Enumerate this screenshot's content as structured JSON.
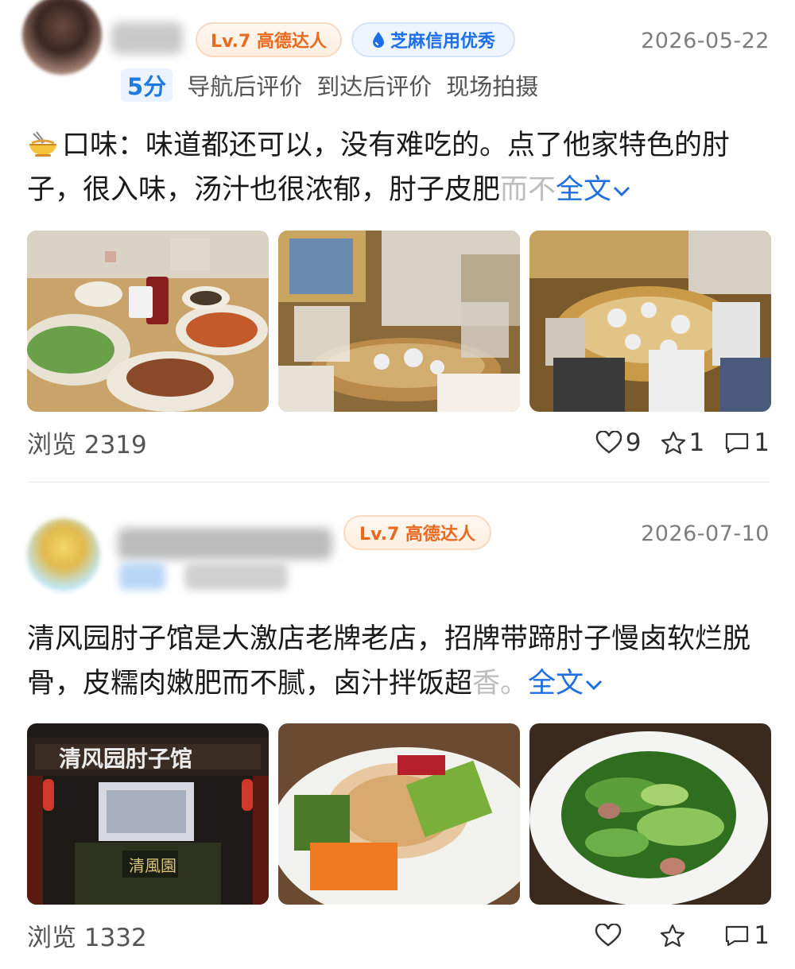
{
  "reviews": [
    {
      "user_level": "Lv.7 高德达人",
      "credit_badge": "芝麻信用优秀",
      "date": "2026-05-22",
      "score": "5分",
      "tags": [
        "导航后评价",
        "到达后评价",
        "现场拍摄"
      ],
      "text_main": "口味：味道都还可以，没有难吃的。点了他家特色的肘子，很入味，汤汁也很浓郁，肘子皮肥",
      "text_fade": "而不",
      "more_label": "全文",
      "views": "浏览 2319",
      "likes": "9",
      "favorites": "1",
      "comments": "1"
    },
    {
      "user_level": "Lv.7 高德达人",
      "date": "2026-07-10",
      "text_main": "清风园肘子馆是大激店老牌老店，招牌带蹄肘子慢卤软烂脱骨，皮糯肉嫩肥而不腻，卤汁拌饭超",
      "text_fade": "香。",
      "more_label": "全文",
      "views": "浏览 1332",
      "likes": "",
      "favorites": "",
      "comments": "1"
    }
  ],
  "icons": {
    "noodle": "noodle-bowl-icon",
    "drop": "water-drop-icon",
    "chevron": "chevron-down-icon",
    "like": "heart-icon",
    "fav": "star-icon",
    "comment": "comment-icon"
  },
  "colors": {
    "level_text": "#e86a1f",
    "credit_text": "#1d6fe8",
    "link": "#1f6fe0",
    "score_text": "#1f7ae0"
  }
}
